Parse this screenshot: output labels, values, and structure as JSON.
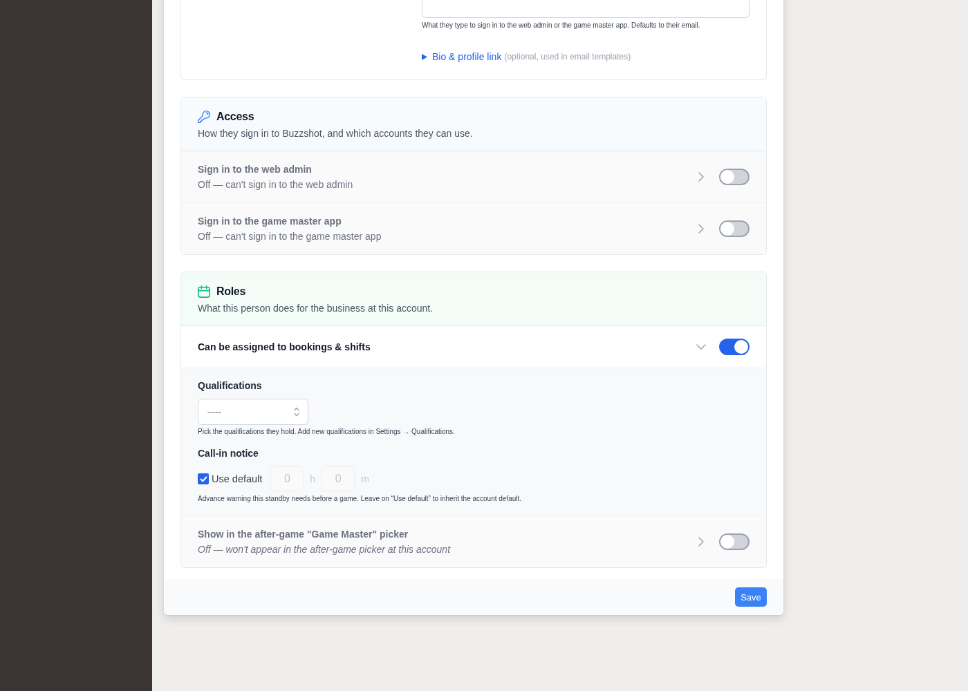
{
  "login_section": {
    "login_field": {
      "hint": "What they type to sign in to the web admin or the game master app. Defaults to their email."
    },
    "bio_disclosure": {
      "label": "Bio & profile link",
      "note": "(optional, used in email templates)",
      "expanded": false
    }
  },
  "sections": [
    {
      "kind": "access",
      "title": "Access",
      "description": "How they sign in to Buzzshot, and which accounts they can use.",
      "rows": [
        {
          "kind": "permission",
          "title": "Sign in to the web admin",
          "status": "Off — can't sign in to the web admin",
          "on": false,
          "expanded": false
        },
        {
          "kind": "permission",
          "title": "Sign in to the game master app",
          "status": "Off — can't sign in to the game master app",
          "on": false,
          "expanded": false
        }
      ]
    },
    {
      "kind": "roles",
      "title": "Roles",
      "description": "What this person does for the business at this account.",
      "rows": [
        {
          "kind": "role",
          "title": "Can be assigned to bookings & shifts",
          "on": true,
          "expanded": true,
          "details": {
            "qualifications": {
              "label": "Qualifications",
              "value": "-----",
              "hint": "Pick the qualifications they hold. Add new qualifications in Settings → Qualifications."
            },
            "call_in_notice": {
              "label": "Call-in notice",
              "use_default": {
                "label": "Use default",
                "checked": true
              },
              "hours": {
                "placeholder": "0",
                "unit": "h"
              },
              "minutes": {
                "placeholder": "0",
                "unit": "m"
              },
              "hint": "Advance warning this standby needs before a game. Leave on “Use default” to inherit the account default."
            }
          }
        },
        {
          "kind": "visibility",
          "title": "Show in the after-game \"Game Master\" picker",
          "status": "Off — won't appear in the after-game picker at this account",
          "on": false,
          "expanded": false
        }
      ]
    }
  ],
  "footer": {
    "save_button": "Save"
  }
}
